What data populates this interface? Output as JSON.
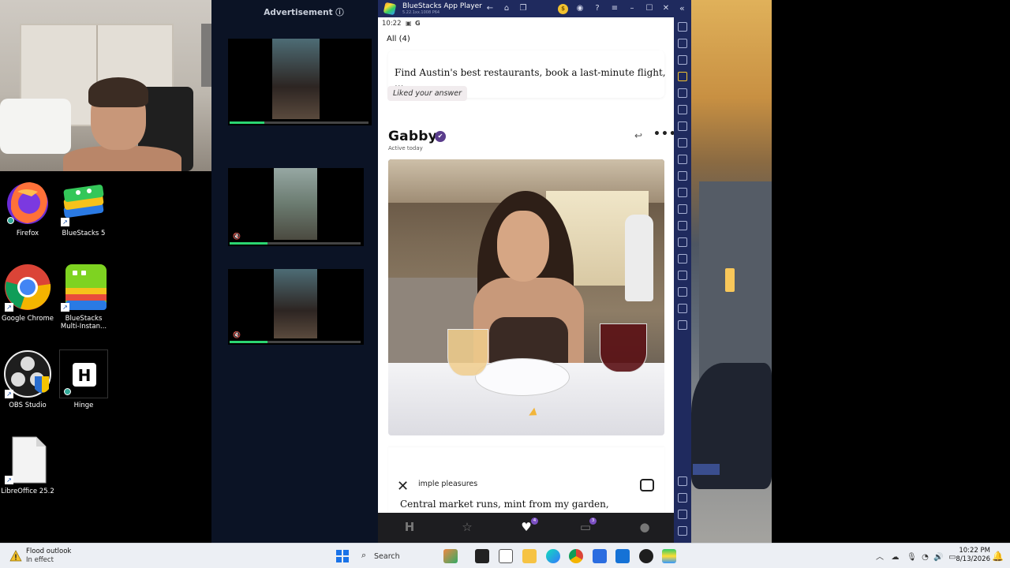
{
  "desktop": {
    "icons": [
      {
        "label": "Firefox"
      },
      {
        "label": "BlueStacks 5"
      },
      {
        "label": "Google Chrome"
      },
      {
        "label": "BlueStacks Multi-Instan..."
      },
      {
        "label": "OBS Studio"
      },
      {
        "label": "Hinge"
      },
      {
        "label": "LibreOffice 25.2"
      }
    ]
  },
  "ad": {
    "title": "Advertisement ⓘ"
  },
  "bluestacks": {
    "title": "BlueStacks App Player",
    "version": "5.22.1xx.1008 P64",
    "coin_label": "$"
  },
  "phone": {
    "status_time": "10:22",
    "filter_label": "All (4)",
    "prompt_text": "Find Austin's best restaurants, book a last-minute flight, ...",
    "liked_label": "Liked your answer",
    "profile": {
      "name": "Gabby",
      "verified_mark": "✔",
      "activity": "Active today"
    },
    "prompt2": {
      "question": "imple pleasures",
      "answer": "Central market runs, mint from my garden,"
    },
    "nav": {
      "likes_badge": "4",
      "chats_badge": "3"
    }
  },
  "taskbar": {
    "weather_title": "Flood outlook",
    "weather_subtitle": "In effect",
    "search_label": "Search",
    "clock_time": "10:22 PM",
    "clock_date": "8/13/2026"
  },
  "colors": {
    "bluestacks_chrome": "#1f2a5e",
    "hinge_purple": "#5a3d8c",
    "ad_panel_bg": "#0b1325",
    "video_progress": "#2bd672"
  },
  "ad_videos": [
    {
      "progress": 0.25
    },
    {
      "progress": 0.29
    },
    {
      "progress": 0.29
    }
  ]
}
